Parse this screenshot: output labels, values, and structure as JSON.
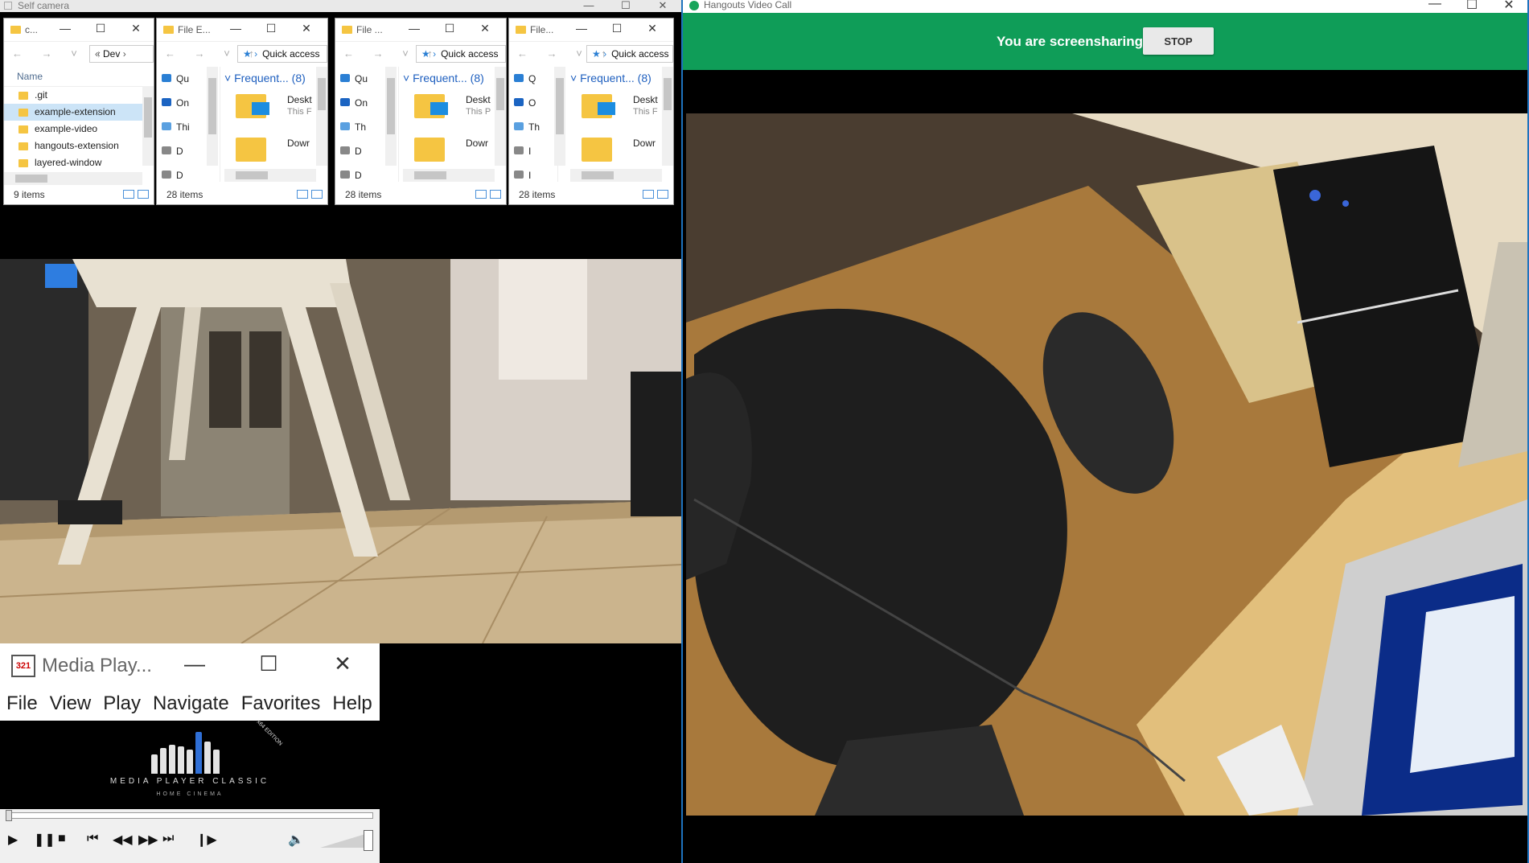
{
  "self_camera": {
    "title": "Self camera",
    "caption_buttons": [
      "—",
      "☐",
      "✕"
    ]
  },
  "explorer_list": {
    "title": "c...",
    "address": "Dev",
    "column_header": "Name",
    "files": [
      ".git",
      "example-extension",
      "example-video",
      "hangouts-extension",
      "layered-window"
    ],
    "selected_index": 1,
    "status": "9 items"
  },
  "explorers": [
    {
      "title": "File E...",
      "address": "Quick access",
      "nav": [
        "Qu",
        "On",
        "Thi",
        "D",
        "D"
      ],
      "frequent": "Frequent... (8)",
      "items": [
        {
          "name": "Deskt",
          "sub": "This F"
        },
        {
          "name": "Dowr",
          "sub": ""
        }
      ],
      "status": "28 items"
    },
    {
      "title": "File ...",
      "address": "Quick access",
      "nav": [
        "Qu",
        "On",
        "Th",
        "D",
        "D"
      ],
      "frequent": "Frequent... (8)",
      "items": [
        {
          "name": "Deskt",
          "sub": "This P"
        },
        {
          "name": "Dowr",
          "sub": ""
        }
      ],
      "status": "28 items"
    },
    {
      "title": "File...",
      "address": "Quick access",
      "nav": [
        "Q",
        "O",
        "Th",
        "I",
        "I"
      ],
      "frequent": "Frequent... (8)",
      "items": [
        {
          "name": "Deskt",
          "sub": "This F"
        },
        {
          "name": "Dowr",
          "sub": ""
        }
      ],
      "status": "28 items"
    }
  ],
  "media_player": {
    "title": "Media Play...",
    "icon_text": "321",
    "menu": [
      "File",
      "View",
      "Play",
      "Navigate",
      "Favorites",
      "Help"
    ],
    "brand": "MEDIA PLAYER CLASSIC",
    "brand_sub": "HOME CINEMA",
    "edition": "x64 EDITION",
    "volume": 1.0
  },
  "hangouts": {
    "title": "Hangouts Video Call",
    "share_text": "You are screensharing",
    "stop_label": "STOP",
    "accent": "#0f9d58"
  }
}
